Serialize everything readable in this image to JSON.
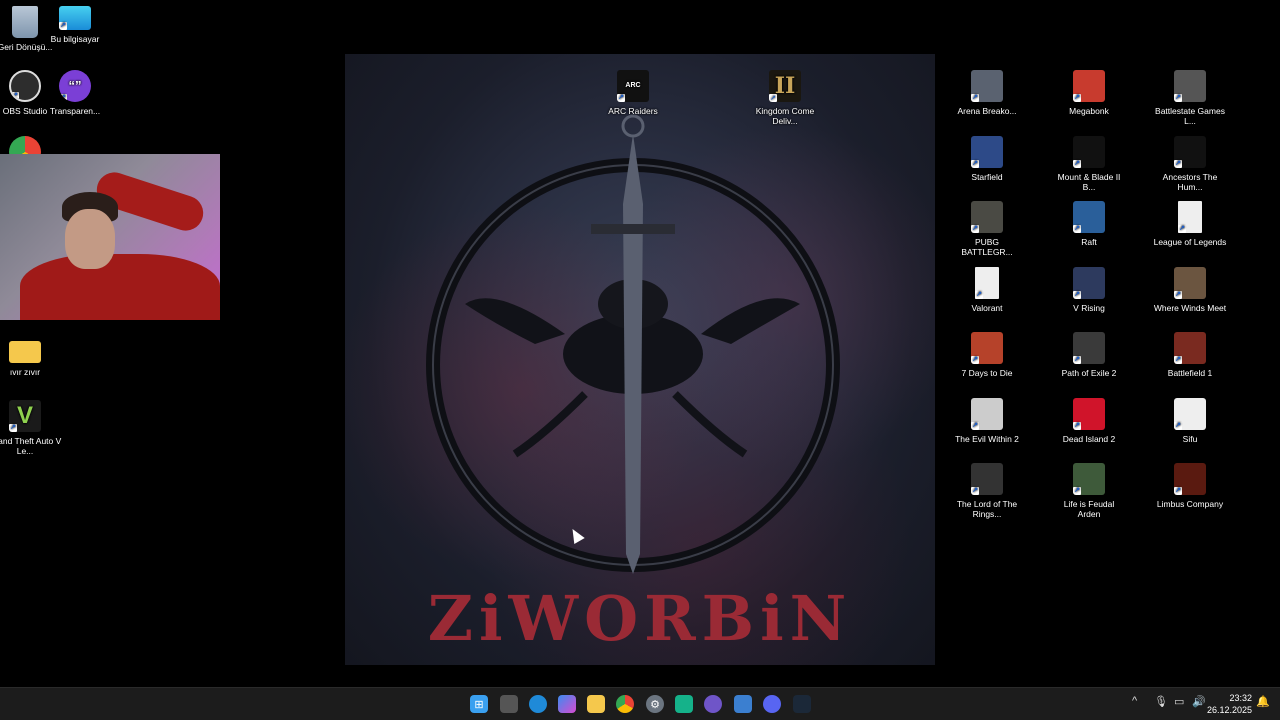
{
  "wallpaper": {
    "title": "ZiWORBiN"
  },
  "left_icons": [
    {
      "label": "Geri Dönüşü...",
      "icon": "recycle-bin-icon"
    },
    {
      "label": "Bu bilgisayar",
      "icon": "computer-icon"
    },
    {
      "label": "OBS Studio",
      "icon": "obs-icon"
    },
    {
      "label": "Transparen...",
      "icon": "chat-bubble-icon"
    },
    {
      "label": "ıvır zıvır",
      "icon": "folder-icon"
    },
    {
      "label": "Grand Theft Auto V Le...",
      "icon": "gta-icon"
    }
  ],
  "center_icons": [
    {
      "label": "ARC Raiders",
      "icon": "arc-raiders-icon"
    },
    {
      "label": "Kingdom Come Deliv...",
      "icon": "kingdom-come-icon"
    }
  ],
  "right_icons": [
    {
      "label": "Arena Breako...",
      "icon": "game-icon"
    },
    {
      "label": "Megabonk",
      "icon": "game-icon"
    },
    {
      "label": "Battlestate Games L...",
      "icon": "game-icon"
    },
    {
      "label": "Starfield",
      "icon": "game-icon"
    },
    {
      "label": "Mount & Blade II B...",
      "icon": "game-icon"
    },
    {
      "label": "Ancestors The Hum...",
      "icon": "game-icon"
    },
    {
      "label": "PUBG BATTLEGR...",
      "icon": "game-icon"
    },
    {
      "label": "Raft",
      "icon": "game-icon"
    },
    {
      "label": "League of Legends",
      "icon": "file-icon"
    },
    {
      "label": "Valorant",
      "icon": "file-icon"
    },
    {
      "label": "V Rising",
      "icon": "game-icon"
    },
    {
      "label": "Where Winds Meet",
      "icon": "game-icon"
    },
    {
      "label": "7 Days to Die",
      "icon": "game-icon"
    },
    {
      "label": "Path of Exile 2",
      "icon": "game-icon"
    },
    {
      "label": "Battlefield 1",
      "icon": "game-icon"
    },
    {
      "label": "The Evil Within 2",
      "icon": "game-icon"
    },
    {
      "label": "Dead Island 2",
      "icon": "game-icon"
    },
    {
      "label": "Sifu",
      "icon": "game-icon"
    },
    {
      "label": "The Lord of The Rings...",
      "icon": "game-icon"
    },
    {
      "label": "Life is Feudal Arden",
      "icon": "game-icon"
    },
    {
      "label": "Limbus Company",
      "icon": "game-icon"
    }
  ],
  "taskbar": {
    "icons": [
      "windows-start-icon",
      "task-view-icon",
      "edge-icon",
      "copilot-icon",
      "file-explorer-icon",
      "chrome-icon",
      "settings-icon",
      "app-icon",
      "teams-icon",
      "app-icon",
      "discord-icon",
      "steam-icon"
    ],
    "time": "23:32",
    "date": "26.12.2025"
  }
}
